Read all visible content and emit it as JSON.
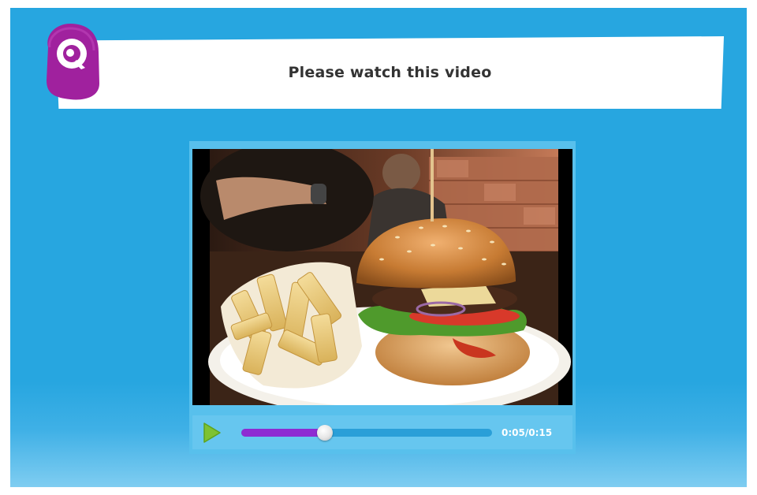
{
  "header": {
    "title": "Please watch this video",
    "logo_icon": "q-logo-icon"
  },
  "player": {
    "play_icon": "play-icon",
    "current_time": "0:05",
    "duration": "0:15",
    "time_display": "0:05/0:15",
    "progress_fraction": 0.333
  },
  "colors": {
    "background": "#27a6e0",
    "banner": "#ffffff",
    "progress_fill": "#8e2bd2",
    "play_icon": "#7ec233",
    "logo": "#a0219e"
  }
}
